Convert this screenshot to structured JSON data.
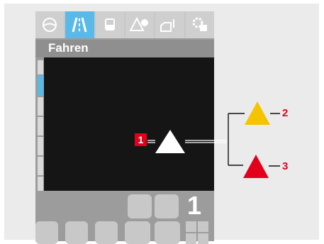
{
  "tabs": [
    {
      "icon": "steering-wheel-icon"
    },
    {
      "icon": "road-lane-icon",
      "active": true
    },
    {
      "icon": "vehicle-front-icon"
    },
    {
      "icon": "warning-triangle-icon"
    },
    {
      "icon": "fuel-pump-icon"
    },
    {
      "icon": "settings-gear-icon"
    }
  ],
  "screen": {
    "title": "Fahren",
    "gear_value": "1"
  },
  "callouts": {
    "box_label": "1",
    "label_2": "2",
    "label_3": "3"
  },
  "colors": {
    "accent_blue": "#59b9e9",
    "warning_yellow": "#f5c400",
    "danger_red": "#e3001b",
    "display_black": "#151515"
  }
}
